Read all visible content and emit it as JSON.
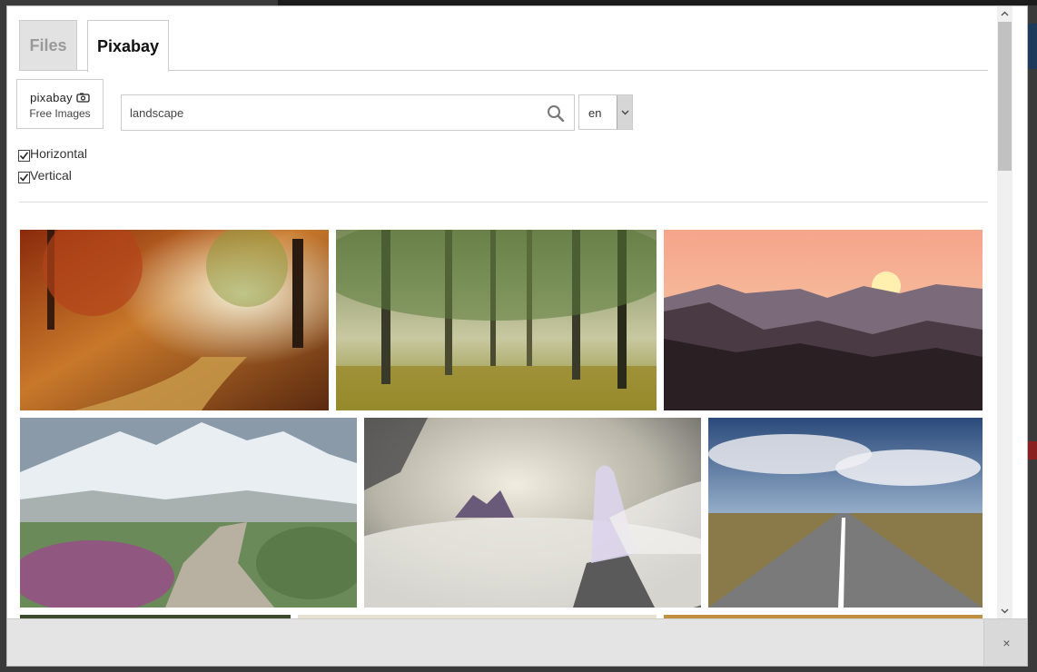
{
  "tabs": [
    {
      "label": "Files",
      "active": false
    },
    {
      "label": "Pixabay",
      "active": true
    }
  ],
  "logo": {
    "brand": "pixabay",
    "subtitle": "Free Images",
    "icon": "camera-icon"
  },
  "search": {
    "value": "landscape",
    "placeholder": "",
    "icon": "search-icon"
  },
  "language": {
    "selected": "en",
    "icon": "chevron-down-icon"
  },
  "filters": [
    {
      "label": "Horizontal",
      "checked": true
    },
    {
      "label": "Vertical",
      "checked": true
    }
  ],
  "photos": [
    {
      "subject": "autumn forest path"
    },
    {
      "subject": "sunlit forest"
    },
    {
      "subject": "mountain sunset silhouette"
    },
    {
      "subject": "snowy mountains stone path"
    },
    {
      "subject": "woman on cliff above clouds with floating castle"
    },
    {
      "subject": "straight road under cloudy sky"
    }
  ],
  "footer": {
    "close_label": "×"
  },
  "colors": {
    "tab_inactive_bg": "#e2e2e2",
    "border": "#cccccc",
    "footer_bg": "#e4e4e4"
  }
}
